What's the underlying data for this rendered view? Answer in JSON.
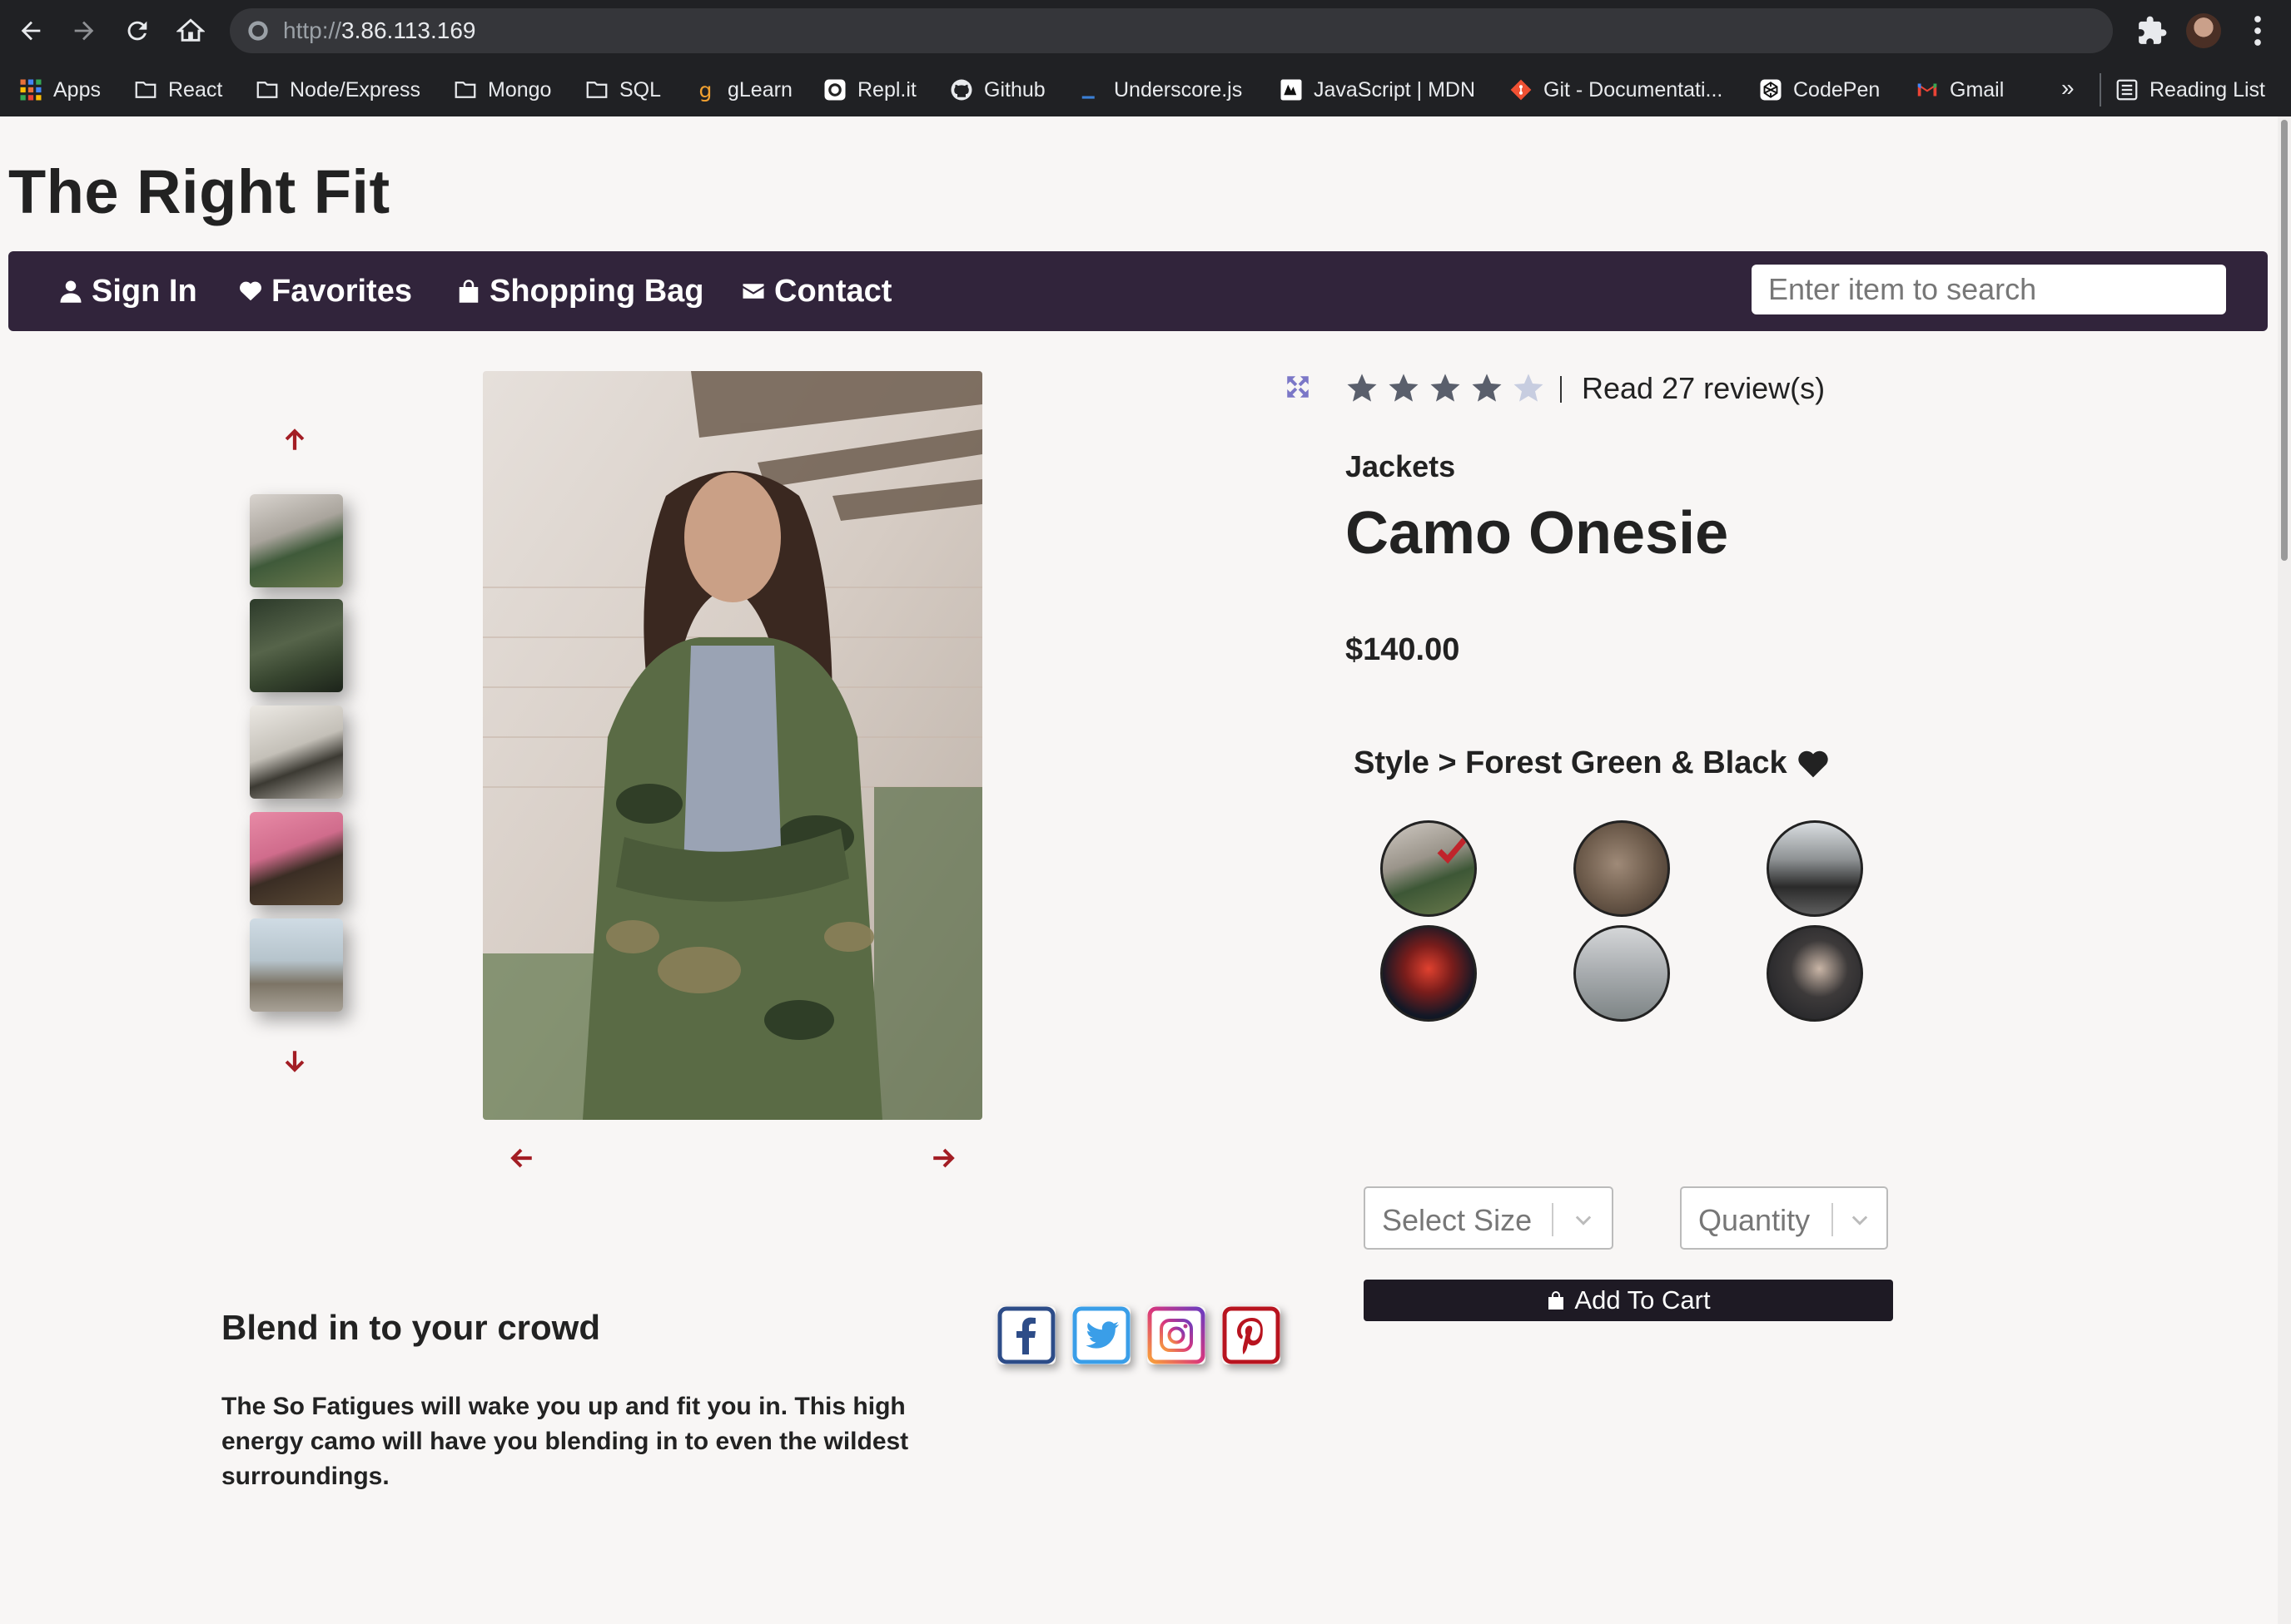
{
  "browser": {
    "url_protocol": "http://",
    "url_host": "3.86.113.169",
    "bookmarks": [
      {
        "label": "Apps",
        "icon": "apps-grid-icon"
      },
      {
        "label": "React",
        "icon": "folder-icon"
      },
      {
        "label": "Node/Express",
        "icon": "folder-icon"
      },
      {
        "label": "Mongo",
        "icon": "folder-icon"
      },
      {
        "label": "SQL",
        "icon": "folder-icon"
      },
      {
        "label": "gLearn",
        "icon": "glearn-icon"
      },
      {
        "label": "Repl.it",
        "icon": "replit-icon"
      },
      {
        "label": "Github",
        "icon": "github-icon"
      },
      {
        "label": "Underscore.js",
        "icon": "underscore-icon"
      },
      {
        "label": "JavaScript | MDN",
        "icon": "mdn-icon"
      },
      {
        "label": "Git - Documentati...",
        "icon": "git-icon"
      },
      {
        "label": "CodePen",
        "icon": "codepen-icon"
      },
      {
        "label": "Gmail",
        "icon": "gmail-icon"
      }
    ],
    "more_label": "»",
    "reading_list_label": "Reading List"
  },
  "site": {
    "title": "The Right Fit",
    "nav": [
      {
        "label": "Sign In",
        "icon": "user-icon"
      },
      {
        "label": "Favorites",
        "icon": "heart-icon"
      },
      {
        "label": "Shopping Bag",
        "icon": "shopping-bag-icon"
      },
      {
        "label": "Contact",
        "icon": "envelope-icon"
      }
    ],
    "search_placeholder": "Enter item to search"
  },
  "product": {
    "rating": 4,
    "rating_max": 5,
    "reviews_label": "Read 27 review(s)",
    "category": "Jackets",
    "name": "Camo Onesie",
    "price": "$140.00",
    "style_label": "Style > Forest Green & Black",
    "thumbnail_count": 5,
    "style_count": 6,
    "selected_style_index": 0,
    "size_placeholder": "Select Size",
    "quantity_placeholder": "Quantity",
    "add_to_cart_label": "Add To Cart",
    "description_title": "Blend in to your crowd",
    "description": "The So Fatigues will wake you up and fit you in. This high energy camo will have you blending in to even the wildest surroundings.",
    "social": [
      "facebook-icon",
      "twitter-icon",
      "instagram-icon",
      "pinterest-icon"
    ]
  },
  "colors": {
    "nav_bg": "#31243b",
    "arrow_red": "#a31d24",
    "cart_bg": "#1e1a24",
    "facebook": "#2d4c88",
    "twitter": "#3a9ee8",
    "instagram": "#b5378f",
    "pinterest": "#b8141f"
  }
}
